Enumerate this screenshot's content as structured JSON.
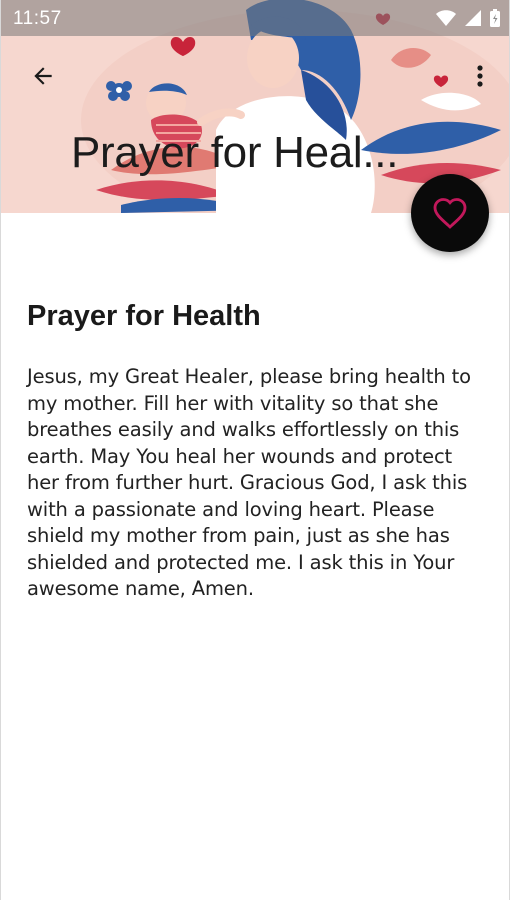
{
  "status_bar": {
    "time": "11:57"
  },
  "toolbar": {
    "collapsed_title": "Prayer for Heal...",
    "back_icon": "arrow-left-icon",
    "menu_icon": "more-vert-icon"
  },
  "fab": {
    "icon": "heart-outline-icon",
    "icon_color": "#c2185b",
    "background": "#0a0a0a"
  },
  "article": {
    "title": "Prayer for Health",
    "body": "Jesus, my Great Healer, please bring health to my mother. Fill her with vitality so that she breathes easily and walks effortlessly on this earth. May You heal her wounds and protect her from further hurt. Gracious God, I ask this with a passionate and loving heart. Please shield my mother from pain, just as she has shielded and protected me. I ask this in Your awesome name, Amen."
  },
  "colors": {
    "header_bg": "#f6d7cf",
    "hair_blue": "#2f5fa8",
    "accent_red": "#c8243a"
  }
}
